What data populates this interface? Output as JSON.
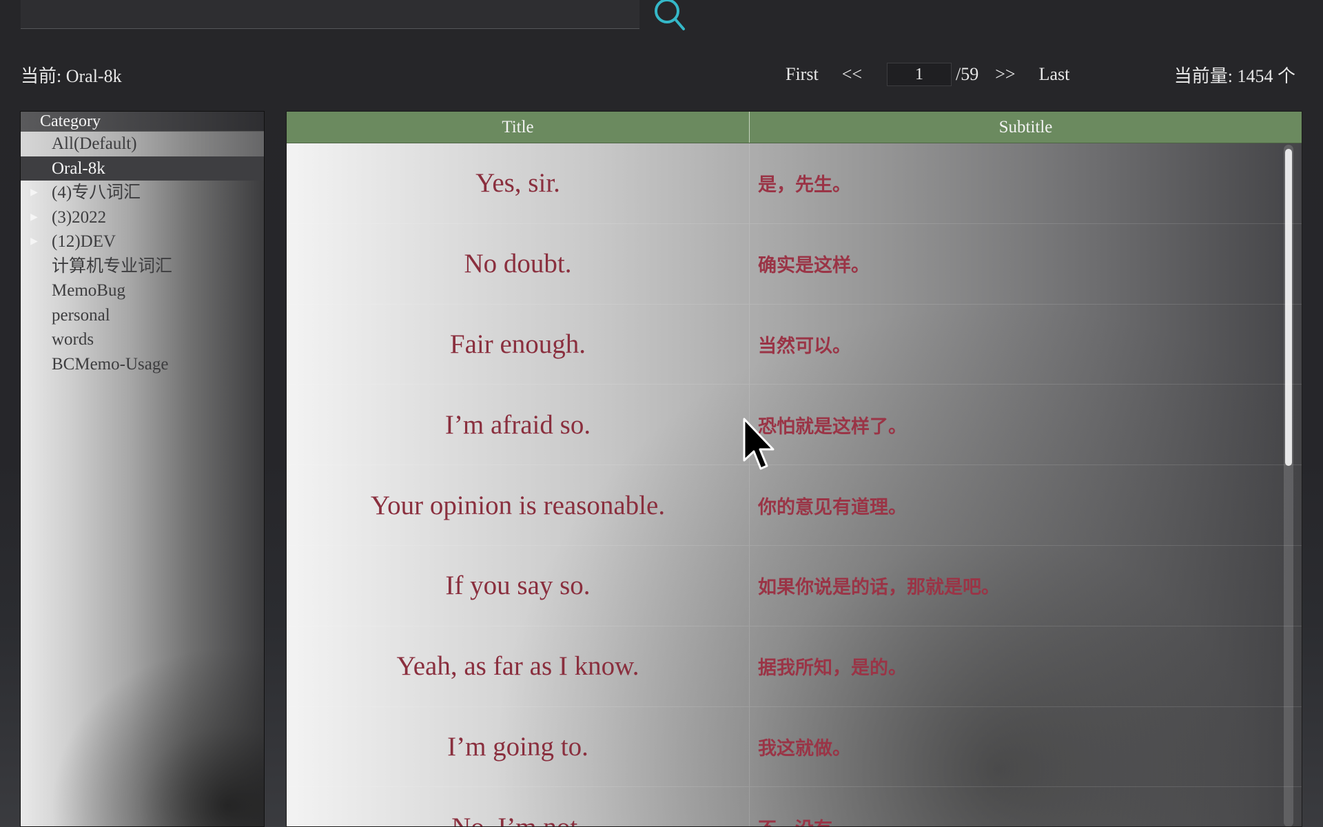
{
  "search": {
    "value": "",
    "placeholder": ""
  },
  "status": {
    "current_label": "当前:",
    "current_value": "Oral-8k",
    "count_label": "当前量:",
    "count_value": "1454",
    "count_unit": "个"
  },
  "pager": {
    "first": "First",
    "prev": "<<",
    "page": "1",
    "total": "/59",
    "next": ">>",
    "last": "Last"
  },
  "sidebar": {
    "header": "Category",
    "items": [
      {
        "label": "All(Default)",
        "expandable": false,
        "selected": false
      },
      {
        "label": "Oral-8k",
        "expandable": false,
        "selected": true
      },
      {
        "label": "(4)专八词汇",
        "expandable": true,
        "selected": false
      },
      {
        "label": "(3)2022",
        "expandable": true,
        "selected": false
      },
      {
        "label": "(12)DEV",
        "expandable": true,
        "selected": false
      },
      {
        "label": "计算机专业词汇",
        "expandable": false,
        "selected": false
      },
      {
        "label": "MemoBug",
        "expandable": false,
        "selected": false
      },
      {
        "label": "personal",
        "expandable": false,
        "selected": false
      },
      {
        "label": "words",
        "expandable": false,
        "selected": false
      },
      {
        "label": "BCMemo-Usage",
        "expandable": false,
        "selected": false
      }
    ]
  },
  "table": {
    "columns": [
      "Title",
      "Subtitle"
    ],
    "rows": [
      {
        "title": "Yes, sir.",
        "subtitle": "是，先生。"
      },
      {
        "title": "No doubt.",
        "subtitle": "确实是这样。"
      },
      {
        "title": "Fair enough.",
        "subtitle": "当然可以。"
      },
      {
        "title": "I’m afraid so.",
        "subtitle": "恐怕就是这样了。"
      },
      {
        "title": "Your opinion is reasonable.",
        "subtitle": "你的意见有道理。"
      },
      {
        "title": "If you say so.",
        "subtitle": "如果你说是的话，那就是吧。"
      },
      {
        "title": "Yeah, as far as I know.",
        "subtitle": "据我所知，是的。"
      },
      {
        "title": "I’m going to.",
        "subtitle": "我这就做。"
      },
      {
        "title": "No, I’m not.",
        "subtitle": "不，没有。"
      }
    ]
  },
  "icons": {
    "search": "search-icon",
    "expand": "triangle-right-icon",
    "cursor": "mouse-pointer-icon"
  },
  "colors": {
    "header_green": "#6b8a5f",
    "title_text": "#8a2f3e",
    "accent_search": "#35b8c8"
  }
}
